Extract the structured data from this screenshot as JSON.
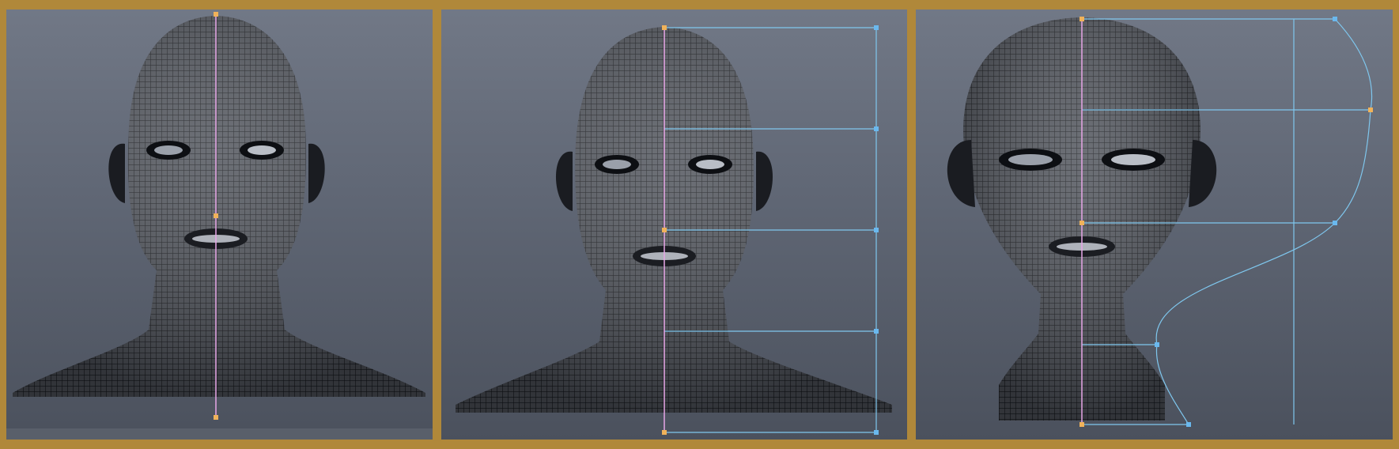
{
  "app": {
    "name": ""
  },
  "colors": {
    "frame": "#b0883a",
    "viewport_bg_top": "#717886",
    "viewport_bg_bottom": "#4b515d",
    "mesh_fill": "#4a4d55",
    "mesh_line": "#111318",
    "symmetry_axis": "#e7a6e7",
    "deform_curve": "#7fc7ee",
    "control_point_active": "#f0b25a",
    "control_point": "#6ab8ee"
  },
  "viewports": [
    {
      "label": "",
      "view": "front",
      "state": "base-mesh"
    },
    {
      "label": "",
      "view": "front",
      "state": "deformer-attached"
    },
    {
      "label": "",
      "view": "front",
      "state": "deformed"
    }
  ]
}
